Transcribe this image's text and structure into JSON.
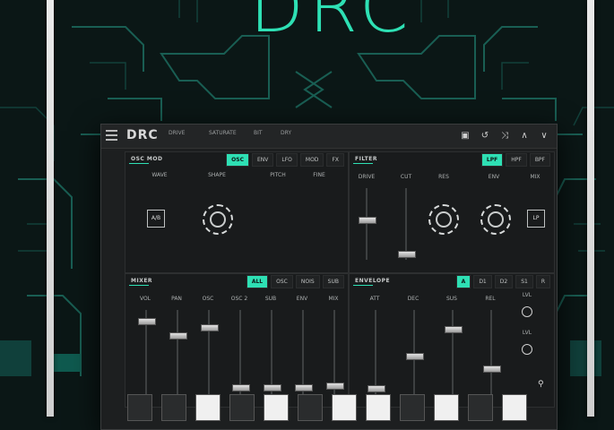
{
  "title": "DRC",
  "header": {
    "logo": "DRC",
    "meta": [
      "DRIVE",
      "SATURATE",
      "BIT",
      "DRY"
    ],
    "icons": [
      "save-icon",
      "undo-icon",
      "shuffle-icon",
      "chevron-up-icon",
      "chevron-down-icon"
    ]
  },
  "panel_osc": {
    "title": "OSC MOD",
    "tabs": [
      {
        "label": "OSC",
        "active": true
      },
      {
        "label": "ENV",
        "active": false
      },
      {
        "label": "LFO",
        "active": false
      },
      {
        "label": "MOD",
        "active": false
      },
      {
        "label": "FX",
        "active": false
      }
    ],
    "labels": [
      "WAVE",
      "SHAPE",
      "PITCH",
      "FINE"
    ],
    "button": "A/B"
  },
  "panel_filter": {
    "title": "FILTER",
    "tabs": [
      {
        "label": "LPF",
        "active": true
      },
      {
        "label": "HPF",
        "active": false
      },
      {
        "label": "BPF",
        "active": false
      }
    ],
    "labels": [
      "DRIVE",
      "",
      "CUT",
      "RES",
      "ENV",
      "MIX"
    ],
    "button": "LP"
  },
  "panel_mixer": {
    "title": "MIXER",
    "tabs": [
      {
        "label": "ALL",
        "active": true
      },
      {
        "label": "OSC",
        "active": false
      },
      {
        "label": "NOIS",
        "active": false
      },
      {
        "label": "SUB",
        "active": false
      }
    ],
    "faders": [
      {
        "label": "VOL",
        "value": 0.9
      },
      {
        "label": "PAN",
        "value": 0.72
      },
      {
        "label": "OSC",
        "value": 0.82
      },
      {
        "label": "OSC 2",
        "value": 0.06
      },
      {
        "label": "SUB",
        "value": 0.06
      },
      {
        "label": "ENV",
        "value": 0.06
      },
      {
        "label": "MIX",
        "value": 0.08
      }
    ]
  },
  "panel_env": {
    "title": "ENVELOPE",
    "tabs": [
      {
        "label": "A",
        "active": true
      },
      {
        "label": "D1",
        "active": false
      },
      {
        "label": "D2",
        "active": false
      },
      {
        "label": "S1",
        "active": false
      },
      {
        "label": "R",
        "active": false
      }
    ],
    "faders": [
      {
        "label": "ATT",
        "value": 0.05
      },
      {
        "label": "DEC",
        "value": 0.45
      },
      {
        "label": "SUS",
        "value": 0.8
      },
      {
        "label": "REL",
        "value": 0.3
      }
    ],
    "circle_labels": [
      "LVL",
      "LVL"
    ]
  },
  "keys": [
    {
      "label": "",
      "color": "dark"
    },
    {
      "label": "",
      "color": "dark"
    },
    {
      "label": "",
      "color": "white"
    },
    {
      "label": "",
      "color": "dark"
    },
    {
      "label": "",
      "color": "white"
    },
    {
      "label": "",
      "color": "dark"
    },
    {
      "label": "",
      "color": "white"
    },
    {
      "label": "",
      "color": "white"
    },
    {
      "label": "",
      "color": "dark"
    },
    {
      "label": "",
      "color": "white"
    },
    {
      "label": "",
      "color": "dark"
    },
    {
      "label": "",
      "color": "white"
    }
  ],
  "colors": {
    "accent": "#2ee0b4",
    "panel": "#191b1c",
    "background": "#0b1716"
  }
}
